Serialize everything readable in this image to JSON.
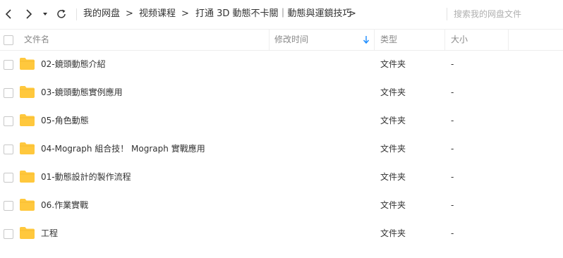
{
  "breadcrumb": {
    "items": [
      "我的网盘",
      "视频课程",
      "打通 3D 動態不卡關｜動態與運鏡技巧"
    ],
    "separator": ">"
  },
  "search": {
    "placeholder": "搜索我的网盘文件"
  },
  "columns": {
    "name": "文件名",
    "modified": "修改时间",
    "type": "类型",
    "size": "大小"
  },
  "files": [
    {
      "name": "02-鏡頭動態介紹",
      "type": "文件夹",
      "size": "-"
    },
    {
      "name": "03-鏡頭動態實例應用",
      "type": "文件夹",
      "size": "-"
    },
    {
      "name": "05-角色動態",
      "type": "文件夹",
      "size": "-"
    },
    {
      "name": "04-Mograph 組合技！ Mograph 實戰應用",
      "type": "文件夹",
      "size": "-"
    },
    {
      "name": "01-動態設計的製作流程",
      "type": "文件夹",
      "size": "-"
    },
    {
      "name": "06.作業實戰",
      "type": "文件夹",
      "size": "-"
    },
    {
      "name": "工程",
      "type": "文件夹",
      "size": "-"
    }
  ],
  "colors": {
    "folder": "#FFC83D",
    "accent": "#1a8cff"
  },
  "icons": {
    "back": "chevron-left-icon",
    "forward": "chevron-right-icon",
    "history": "caret-down-icon",
    "refresh": "refresh-icon",
    "folder": "folder-icon",
    "sort": "sort-down-arrow-icon"
  }
}
